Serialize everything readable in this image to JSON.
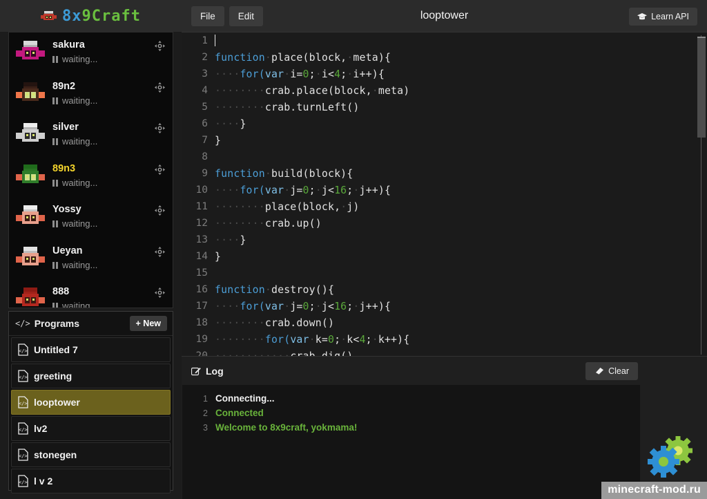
{
  "brand": {
    "name_blue": "8x",
    "name_green": "9Craft",
    "icon": "crab-pixel-icon"
  },
  "toolbar": {
    "file_label": "File",
    "edit_label": "Edit",
    "title": "looptower",
    "learn_api_label": "Learn API",
    "learn_api_icon": "graduation-cap-icon"
  },
  "crabs": {
    "status_icon": "pause-icon",
    "move_icon": "move-arrows-icon",
    "items": [
      {
        "name": "sakura",
        "status": "waiting...",
        "highlight": false,
        "body": "#c2197e",
        "top": "#d8d8d8",
        "topband": "#b3b3b3",
        "arm": "#c2197e",
        "eye": "#2b0c1e"
      },
      {
        "name": "89n2",
        "status": "waiting...",
        "highlight": false,
        "body": "#4a2a1c",
        "top": "#241410",
        "topband": "#3a2017",
        "arm": "#f0764a",
        "eye": "#cfe08a"
      },
      {
        "name": "silver",
        "status": "waiting...",
        "highlight": false,
        "body": "#cfcfcf",
        "top": "#eeeeee",
        "topband": "#b4b4b4",
        "arm": "#cfcfcf",
        "eye": "#2a2a2a"
      },
      {
        "name": "89n3",
        "status": "waiting...",
        "highlight": true,
        "body": "#2f7d2a",
        "top": "#1f6b1b",
        "topband": "#2a7524",
        "arm": "#e0644a",
        "eye": "#cfe08a"
      },
      {
        "name": "Yossy",
        "status": "waiting...",
        "highlight": false,
        "body": "#e8a08c",
        "top": "#ededed",
        "topband": "#c8c8c8",
        "arm": "#e0644a",
        "eye": "#3a1a12"
      },
      {
        "name": "Ueyan",
        "status": "waiting...",
        "highlight": false,
        "body": "#e8a08c",
        "top": "#e2e2e2",
        "topband": "#bdbdbd",
        "arm": "#e0644a",
        "eye": "#3a1a12"
      },
      {
        "name": "888",
        "status": "waiting...",
        "highlight": false,
        "body": "#b3281f",
        "top": "#8e1b14",
        "topband": "#a02219",
        "arm": "#e0644a",
        "eye": "#3a1a12"
      }
    ]
  },
  "programs": {
    "header_icon": "code-brackets-icon",
    "header_label": "Programs",
    "new_button_label": "+ New",
    "file_icon": "code-file-icon",
    "items": [
      {
        "label": "Untitled 7",
        "selected": false
      },
      {
        "label": "greeting",
        "selected": false
      },
      {
        "label": "looptower",
        "selected": true
      },
      {
        "label": "lv2",
        "selected": false
      },
      {
        "label": "stonegen",
        "selected": false
      },
      {
        "label": "l v 2",
        "selected": false
      }
    ]
  },
  "editor": {
    "cursor_line": 1,
    "lines": [
      {
        "n": "1",
        "tokens": []
      },
      {
        "n": "2",
        "tokens": [
          {
            "t": "function",
            "c": "kw"
          },
          {
            "t": "·",
            "c": "ws"
          },
          {
            "t": "place(block,",
            "c": ""
          },
          {
            "t": "·",
            "c": "ws"
          },
          {
            "t": "meta){",
            "c": ""
          }
        ]
      },
      {
        "n": "3",
        "tokens": [
          {
            "t": "····",
            "c": "ws"
          },
          {
            "t": "for(",
            "c": "kw"
          },
          {
            "t": "var",
            "c": "kw2"
          },
          {
            "t": "·",
            "c": "ws"
          },
          {
            "t": "i=",
            "c": ""
          },
          {
            "t": "0",
            "c": "num"
          },
          {
            "t": ";",
            "c": ""
          },
          {
            "t": "·",
            "c": "ws"
          },
          {
            "t": "i<",
            "c": ""
          },
          {
            "t": "4",
            "c": "num"
          },
          {
            "t": ";",
            "c": ""
          },
          {
            "t": "·",
            "c": "ws"
          },
          {
            "t": "i++){",
            "c": ""
          }
        ]
      },
      {
        "n": "4",
        "tokens": [
          {
            "t": "········",
            "c": "ws"
          },
          {
            "t": "crab.place(block,",
            "c": ""
          },
          {
            "t": "·",
            "c": "ws"
          },
          {
            "t": "meta)",
            "c": ""
          }
        ]
      },
      {
        "n": "5",
        "tokens": [
          {
            "t": "········",
            "c": "ws"
          },
          {
            "t": "crab.turnLeft()",
            "c": ""
          }
        ]
      },
      {
        "n": "6",
        "tokens": [
          {
            "t": "····",
            "c": "ws"
          },
          {
            "t": "}",
            "c": ""
          }
        ]
      },
      {
        "n": "7",
        "tokens": [
          {
            "t": "}",
            "c": ""
          }
        ]
      },
      {
        "n": "8",
        "tokens": []
      },
      {
        "n": "9",
        "tokens": [
          {
            "t": "function",
            "c": "kw"
          },
          {
            "t": "·",
            "c": "ws"
          },
          {
            "t": "build(block){",
            "c": ""
          }
        ]
      },
      {
        "n": "10",
        "tokens": [
          {
            "t": "····",
            "c": "ws"
          },
          {
            "t": "for(",
            "c": "kw"
          },
          {
            "t": "var",
            "c": "kw2"
          },
          {
            "t": "·",
            "c": "ws"
          },
          {
            "t": "j=",
            "c": ""
          },
          {
            "t": "0",
            "c": "num"
          },
          {
            "t": ";",
            "c": ""
          },
          {
            "t": "·",
            "c": "ws"
          },
          {
            "t": "j<",
            "c": ""
          },
          {
            "t": "16",
            "c": "num"
          },
          {
            "t": ";",
            "c": ""
          },
          {
            "t": "·",
            "c": "ws"
          },
          {
            "t": "j++){",
            "c": ""
          }
        ]
      },
      {
        "n": "11",
        "tokens": [
          {
            "t": "········",
            "c": "ws"
          },
          {
            "t": "place(block,",
            "c": ""
          },
          {
            "t": "·",
            "c": "ws"
          },
          {
            "t": "j)",
            "c": ""
          }
        ]
      },
      {
        "n": "12",
        "tokens": [
          {
            "t": "········",
            "c": "ws"
          },
          {
            "t": "crab.up()",
            "c": ""
          }
        ]
      },
      {
        "n": "13",
        "tokens": [
          {
            "t": "····",
            "c": "ws"
          },
          {
            "t": "}",
            "c": ""
          }
        ]
      },
      {
        "n": "14",
        "tokens": [
          {
            "t": "}",
            "c": ""
          }
        ]
      },
      {
        "n": "15",
        "tokens": []
      },
      {
        "n": "16",
        "tokens": [
          {
            "t": "function",
            "c": "kw"
          },
          {
            "t": "·",
            "c": "ws"
          },
          {
            "t": "destroy(){",
            "c": ""
          }
        ]
      },
      {
        "n": "17",
        "tokens": [
          {
            "t": "····",
            "c": "ws"
          },
          {
            "t": "for(",
            "c": "kw"
          },
          {
            "t": "var",
            "c": "kw2"
          },
          {
            "t": "·",
            "c": "ws"
          },
          {
            "t": "j=",
            "c": ""
          },
          {
            "t": "0",
            "c": "num"
          },
          {
            "t": ";",
            "c": ""
          },
          {
            "t": "·",
            "c": "ws"
          },
          {
            "t": "j<",
            "c": ""
          },
          {
            "t": "16",
            "c": "num"
          },
          {
            "t": ";",
            "c": ""
          },
          {
            "t": "·",
            "c": "ws"
          },
          {
            "t": "j++){",
            "c": ""
          }
        ]
      },
      {
        "n": "18",
        "tokens": [
          {
            "t": "········",
            "c": "ws"
          },
          {
            "t": "crab.down()",
            "c": ""
          }
        ]
      },
      {
        "n": "19",
        "tokens": [
          {
            "t": "········",
            "c": "ws"
          },
          {
            "t": "for(",
            "c": "kw"
          },
          {
            "t": "var",
            "c": "kw2"
          },
          {
            "t": "·",
            "c": "ws"
          },
          {
            "t": "k=",
            "c": ""
          },
          {
            "t": "0",
            "c": "num"
          },
          {
            "t": ";",
            "c": ""
          },
          {
            "t": "·",
            "c": "ws"
          },
          {
            "t": "k<",
            "c": ""
          },
          {
            "t": "4",
            "c": "num"
          },
          {
            "t": ";",
            "c": ""
          },
          {
            "t": "·",
            "c": "ws"
          },
          {
            "t": "k++){",
            "c": ""
          }
        ]
      },
      {
        "n": "20",
        "tokens": [
          {
            "t": "············",
            "c": "ws"
          },
          {
            "t": "crab.dig()",
            "c": ""
          }
        ]
      }
    ]
  },
  "log": {
    "icon": "pencil-square-icon",
    "title": "Log",
    "clear_label": "Clear",
    "clear_icon": "eraser-icon",
    "lines": [
      {
        "n": "1",
        "text": "Connecting...",
        "level": "info"
      },
      {
        "n": "2",
        "text": "Connected",
        "level": "ok"
      },
      {
        "n": "3",
        "text": "Welcome to 8x9craft, yokmama!",
        "level": "ok"
      }
    ]
  },
  "watermark": {
    "text": "minecraft-mod.ru",
    "icon": "gears-icon",
    "gear_blue": "#2e8fd4",
    "gear_green": "#8dc63f"
  }
}
